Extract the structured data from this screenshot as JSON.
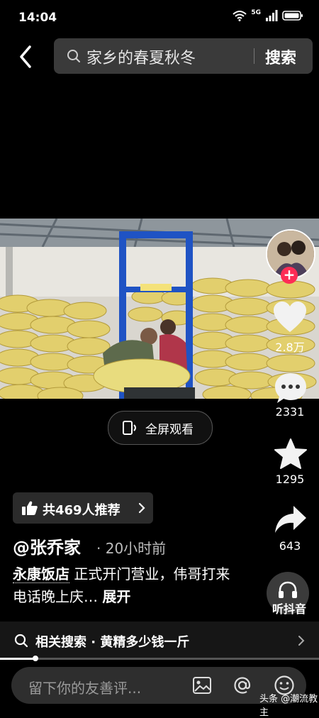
{
  "status_bar": {
    "time": "14:04",
    "network": "5G",
    "battery": ""
  },
  "search": {
    "query": "家乡的春夏秋冬",
    "button": "搜索"
  },
  "video": {
    "fullscreen_label": "全屏观看"
  },
  "rail": {
    "likes": "2.8万",
    "comments": "2331",
    "favorites": "1295",
    "shares": "643",
    "listen": "听抖音"
  },
  "post": {
    "recommend": "共469人推荐",
    "author": "@张乔家",
    "time_ago": "· 20小时前",
    "desc_tag": "永康饭店",
    "desc_text": "正式开门营业，伟哥打来电话晚上庆…",
    "expand": "展开"
  },
  "related": {
    "label": "相关搜索 · 黄精多少钱一斤"
  },
  "comment": {
    "placeholder": "留下你的友善评..."
  },
  "watermark": "头条 @潮流教主",
  "playback": {
    "progress": 0.11
  },
  "colors": {
    "accent": "#fe2c55",
    "bag": "#e3cf6a",
    "lift": "#1f53c4"
  }
}
